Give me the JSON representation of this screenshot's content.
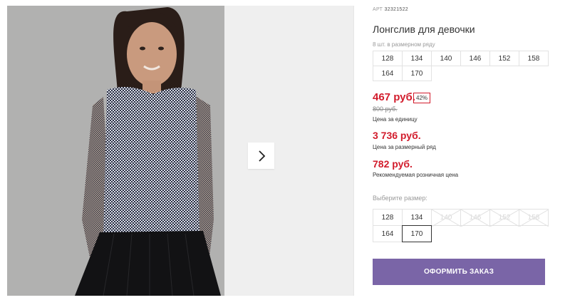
{
  "gallery": {
    "image_alt": "girl wearing checked long-sleeve top",
    "next_icon": "chevron-right-icon"
  },
  "product": {
    "article_label": "АРТ",
    "article_number": "32321522",
    "title": "Лонгслив для девочки",
    "size_set_note": "8 шт. в размерном ряду",
    "size_set": [
      "128",
      "134",
      "140",
      "146",
      "152",
      "158",
      "164",
      "170"
    ]
  },
  "pricing": {
    "price": "467 руб.",
    "discount": "42%",
    "old_price": "800 руб.",
    "price_caption": "Цена за единицу",
    "set_price": "3 736 руб.",
    "set_caption": "Цена за размерный ряд",
    "retail_price": "782 руб.",
    "retail_caption": "Рекомендуемая розничная цена"
  },
  "size_picker": {
    "label": "Выберите размер:",
    "sizes": [
      {
        "label": "128",
        "available": true,
        "selected": false
      },
      {
        "label": "134",
        "available": true,
        "selected": false
      },
      {
        "label": "140",
        "available": false,
        "selected": false
      },
      {
        "label": "146",
        "available": false,
        "selected": false
      },
      {
        "label": "152",
        "available": false,
        "selected": false
      },
      {
        "label": "158",
        "available": false,
        "selected": false
      },
      {
        "label": "164",
        "available": true,
        "selected": false
      },
      {
        "label": "170",
        "available": true,
        "selected": true
      }
    ]
  },
  "actions": {
    "order_label": "ОФОРМИТЬ ЗАКАЗ"
  },
  "colors": {
    "price_red": "#d21c2c",
    "button_purple": "#7a65a7"
  }
}
